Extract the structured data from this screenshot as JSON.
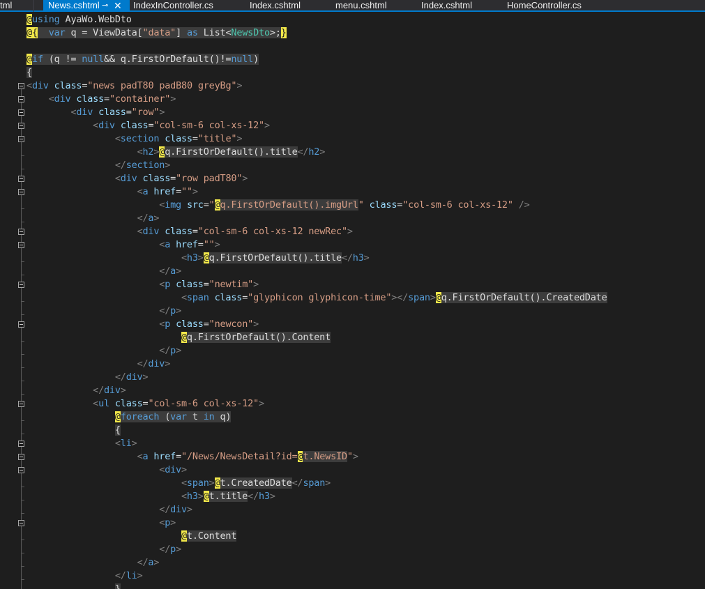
{
  "tabs": [
    {
      "label": "tml",
      "active": false
    },
    {
      "label": "News.cshtml",
      "active": true
    },
    {
      "label": "IndexInController.cs",
      "active": false
    },
    {
      "label": "Index.cshtml",
      "active": false
    },
    {
      "label": "menu.cshtml",
      "active": false
    },
    {
      "label": "Index.cshtml",
      "active": false
    },
    {
      "label": "HomeController.cs",
      "active": false
    }
  ],
  "tab_icons": {
    "pin": "pin-icon",
    "close": "close-icon"
  },
  "colors": {
    "accent": "#007acc",
    "editor_bg": "#1e1e1e",
    "razor_marker": "#f2e84a",
    "keyword": "#569cd6",
    "type": "#4ec9b0",
    "string": "#d69d85",
    "attribute": "#9cdcfe"
  },
  "code": {
    "lines": [
      "@using AyaWo.WebDto",
      "@{  var q = ViewData[\"data\"] as List<NewsDto>;}",
      "",
      "@if (q != null&& q.FirstOrDefault()!=null)",
      "{",
      "<div class=\"news padT80 padB80 greyBg\">",
      "    <div class=\"container\">",
      "        <div class=\"row\">",
      "            <div class=\"col-sm-6 col-xs-12\">",
      "                <section class=\"title\">",
      "                    <h2>@q.FirstOrDefault().title</h2>",
      "                </section>",
      "                <div class=\"row padT80\">",
      "                    <a href=\"\">",
      "                        <img src=\"@q.FirstOrDefault().imgUrl\" class=\"col-sm-6 col-xs-12\" />",
      "                    </a>",
      "                    <div class=\"col-sm-6 col-xs-12 newRec\">",
      "                        <a href=\"\">",
      "                            <h3>@q.FirstOrDefault().title</h3>",
      "                        </a>",
      "                        <p class=\"newtim\">",
      "                            <span class=\"glyphicon glyphicon-time\"></span>@q.FirstOrDefault().CreatedDate",
      "                        </p>",
      "                        <p class=\"newcon\">",
      "                            @q.FirstOrDefault().Content",
      "                        </p>",
      "                    </div>",
      "                </div>",
      "            </div>",
      "            <ul class=\"col-sm-6 col-xs-12\">",
      "                @foreach (var t in q)",
      "                {",
      "                <li>",
      "                    <a href=\"/News/NewsDetail?id=@t.NewsID\">",
      "                        <div>",
      "                            <span>@t.CreatedDate</span>",
      "                            <h3>@t.title</h3>",
      "                        </div>",
      "                        <p>",
      "                            @t.Content",
      "                        </p>",
      "                    </a>",
      "                </li>",
      "                }"
    ]
  }
}
